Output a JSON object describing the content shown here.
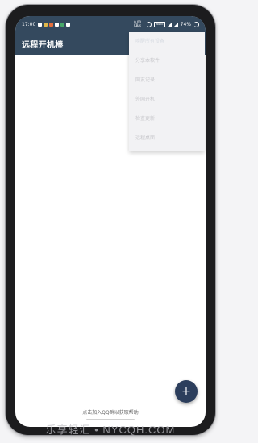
{
  "status_bar": {
    "time": "17:00",
    "speed": "0.00 KB/s",
    "network": "VoLTE",
    "battery": "74%"
  },
  "app_bar": {
    "title": "远程开机棒",
    "settings_icon": "gear-icon",
    "overflow_icon": "more-vert-icon"
  },
  "menu": {
    "items": [
      {
        "label": "唤醒所有设备"
      },
      {
        "label": "分享本软件"
      },
      {
        "label": "网友记录"
      },
      {
        "label": "外网开机"
      },
      {
        "label": "检查更新"
      },
      {
        "label": "远程桌面"
      }
    ]
  },
  "footer": {
    "help_text": "点击加入QQ群以获取帮助"
  },
  "fab": {
    "icon": "plus-icon",
    "symbol": "+"
  },
  "watermark": {
    "text": "乐享轻汇 • NYCQH.COM"
  },
  "colors": {
    "primary": "#34495e",
    "fab": "#2c3e5c",
    "menu_bg": "#f2f2f4"
  }
}
